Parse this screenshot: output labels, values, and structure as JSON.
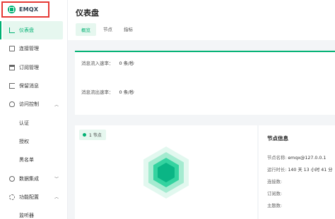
{
  "brand": {
    "name": "EMQX",
    "color": "#00b173"
  },
  "sidebar": {
    "items": [
      {
        "label": "仪表盘",
        "icon": "dashboard-icon",
        "active": true
      },
      {
        "label": "连接管理",
        "icon": "connections-icon"
      },
      {
        "label": "订阅管理",
        "icon": "subscriptions-icon"
      },
      {
        "label": "保留消息",
        "icon": "retained-icon"
      },
      {
        "label": "访问控制",
        "icon": "access-control-icon",
        "expanded": true
      },
      {
        "label": "认证",
        "sub": true
      },
      {
        "label": "授权",
        "sub": true
      },
      {
        "label": "黑名单",
        "sub": true
      },
      {
        "label": "数据集成",
        "icon": "data-integration-icon",
        "expanded": false
      },
      {
        "label": "功能配置",
        "icon": "config-icon",
        "expanded": true
      },
      {
        "label": "监听器",
        "sub": true
      }
    ]
  },
  "header": {
    "title": "仪表盘",
    "tabs": [
      {
        "label": "概览",
        "active": true
      },
      {
        "label": "节点"
      },
      {
        "label": "指标"
      }
    ]
  },
  "rates": {
    "in_label": "消息流入速率：",
    "in_value": "0 条/秒",
    "out_label": "消息流出速率：",
    "out_value": "0 条/秒"
  },
  "nodes": {
    "badge": "1 节点"
  },
  "node_info": {
    "title": "节点信息",
    "name_label": "节点名称:",
    "name_value": "emqx@127.0.0.1",
    "uptime_label": "运行时长:",
    "uptime_value": "140 天 13 小时 41 分",
    "conn_label": "连接数:",
    "sub_label": "订阅数:",
    "topic_label": "主题数:"
  }
}
